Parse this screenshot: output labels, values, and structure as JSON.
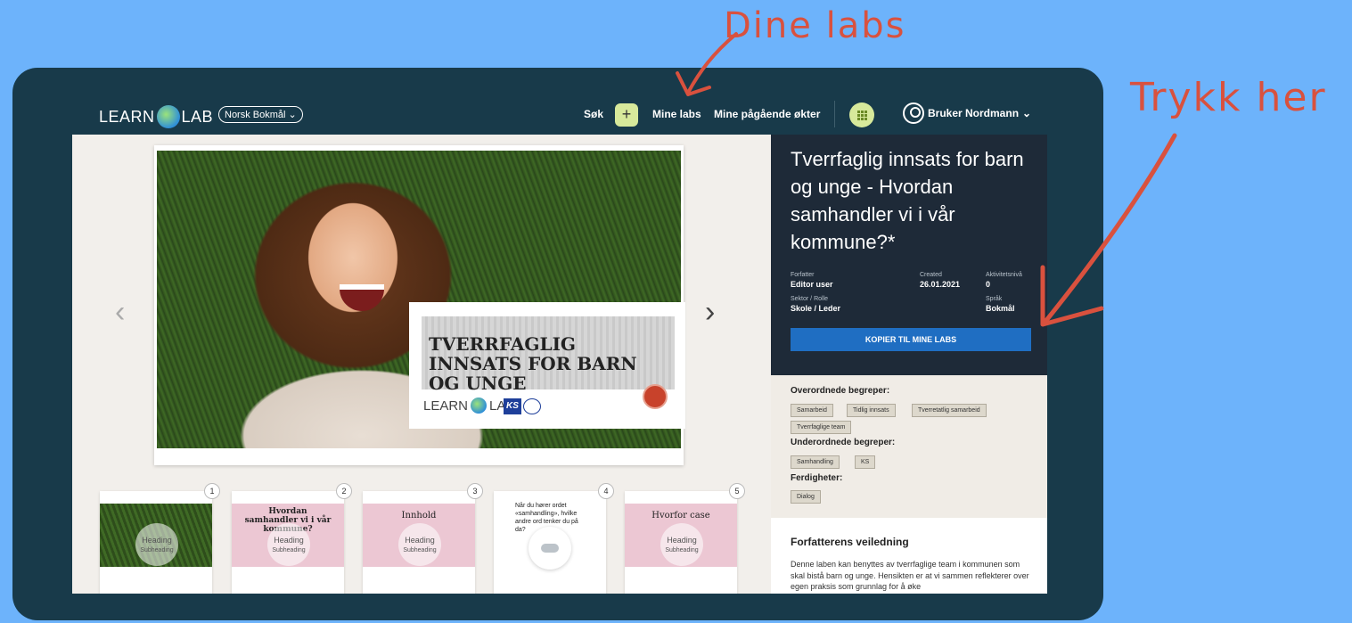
{
  "annotations": {
    "dine_labs": "Dine labs",
    "trykk_her": "Trykk her"
  },
  "colors": {
    "annotation": "#d9513e",
    "background": "#6db3fb",
    "frame": "#183a4a",
    "copy_button": "#1f6ec2",
    "accent_green": "#d7e99b"
  },
  "topbar": {
    "logo": {
      "left": "LEARN",
      "right": "LAB"
    },
    "language": "Norsk Bokmål",
    "search": "Søk",
    "add_icon": "plus-icon",
    "my_labs": "Mine labs",
    "my_sessions": "Mine pågående økter",
    "apps_icon": "grid-icon",
    "user": "Bruker Nordmann"
  },
  "main_slide": {
    "title": "TVERRFAGLIG INNSATS FOR BARN OG UNGE",
    "logo_left": "LEARN",
    "logo_right": "LAB",
    "partner": "KS"
  },
  "thumbnails": [
    {
      "number": "1",
      "title": "",
      "heading": "Heading",
      "subheading": "Subheading"
    },
    {
      "number": "2",
      "title": "Hvordan samhandler vi i vår kommune?",
      "heading": "Heading",
      "subheading": "Subheading"
    },
    {
      "number": "3",
      "title": "Innhold",
      "heading": "Heading",
      "subheading": "Subheading"
    },
    {
      "number": "4",
      "title": "Når du hører ordet «samhandling», hvilke andre ord tenker du på da?",
      "heading": "",
      "subheading": ""
    },
    {
      "number": "5",
      "title": "Hvorfor case",
      "heading": "Heading",
      "subheading": "Subheading"
    }
  ],
  "panel": {
    "title": "Tverrfaglig innsats for barn og unge - Hvordan samhandler vi i vår kommune?*",
    "author_label": "Forfatter",
    "author": "Editor user",
    "created_label": "Created",
    "created": "26.01.2021",
    "activity_label": "Aktivitetsnivå",
    "activity": "0",
    "sector_label": "Sektor / Rolle",
    "sector": "Skole / Leder",
    "language_label": "Språk",
    "language": "Bokmål",
    "copy_button": "KOPIER TIL MINE LABS",
    "superordinate_heading": "Overordnede begreper:",
    "superordinate_tags": [
      "Samarbeid",
      "Tidlig innsats",
      "Tverretatlig samarbeid",
      "Tverrfaglige team"
    ],
    "subordinate_heading": "Underordnede begreper:",
    "subordinate_tags": [
      "Samhandling",
      "KS"
    ],
    "skills_heading": "Ferdigheter:",
    "skills_tags": [
      "Dialog"
    ],
    "guide_heading": "Forfatterens veiledning",
    "guide_text": "Denne laben kan benyttes av tverrfaglige team i kommunen som skal bistå barn og unge. Hensikten er at vi sammen reflekterer over egen praksis som grunnlag for å øke"
  }
}
